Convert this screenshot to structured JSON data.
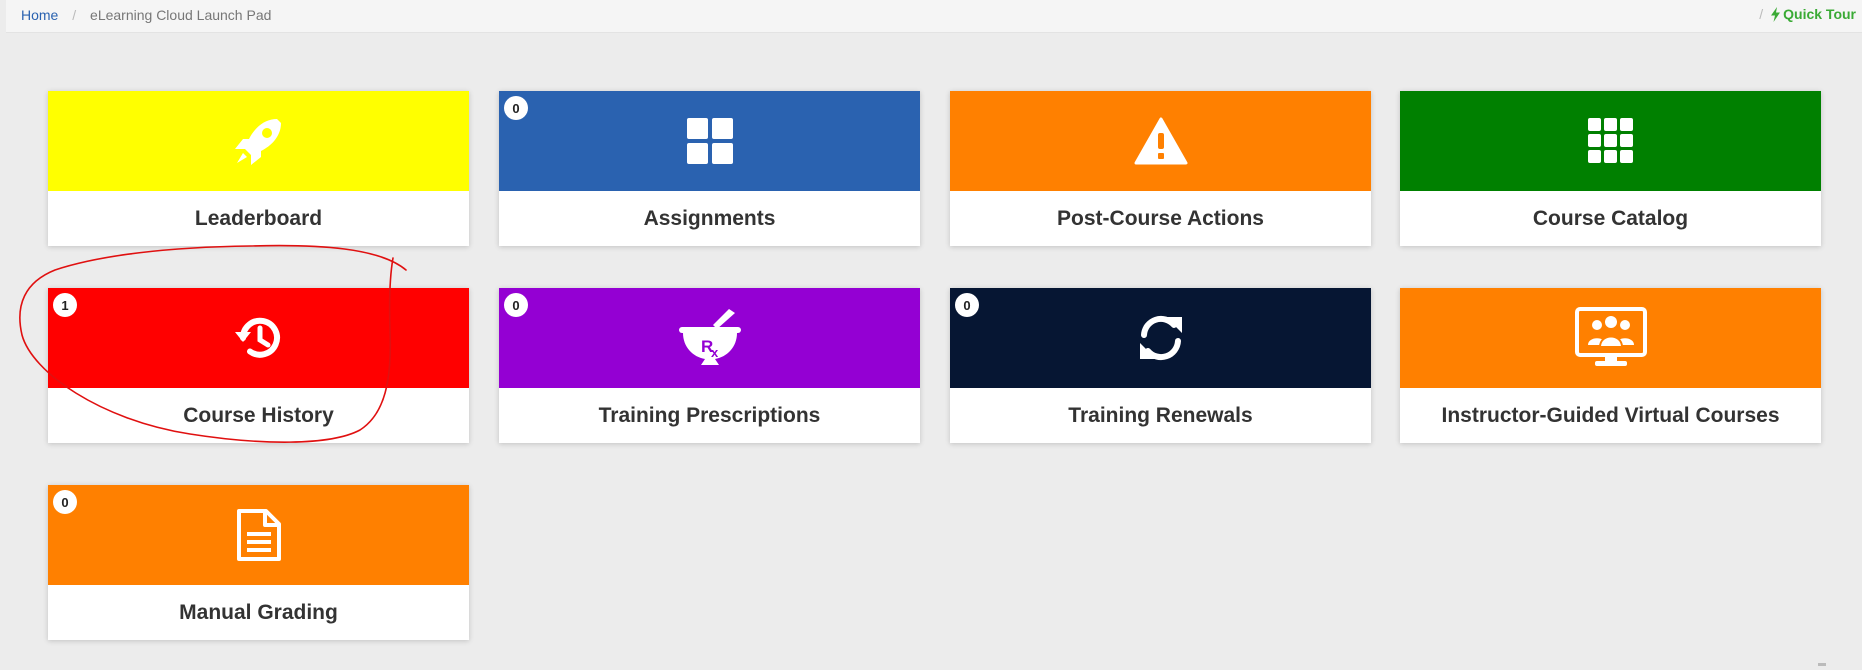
{
  "breadcrumb": {
    "home": "Home",
    "separator": "/",
    "current": "eLearning Cloud Launch Pad"
  },
  "quick_tour": {
    "separator": "/",
    "label": "Quick Tour",
    "color": "#3aaa35",
    "icon": "bolt-icon"
  },
  "tiles": [
    {
      "label": "Leaderboard",
      "color": "#ffff00",
      "icon": "rocket-icon",
      "badge": null
    },
    {
      "label": "Assignments",
      "color": "#2a62b0",
      "icon": "grid-icon",
      "badge": "0"
    },
    {
      "label": "Post-Course Actions",
      "color": "#ff8000",
      "icon": "warning-icon",
      "badge": null
    },
    {
      "label": "Course Catalog",
      "color": "#008000",
      "icon": "apps-grid-icon",
      "badge": null
    },
    {
      "label": "Course History",
      "color": "#ff0000",
      "icon": "history-icon",
      "badge": "1"
    },
    {
      "label": "Training Prescriptions",
      "color": "#9400d3",
      "icon": "mortar-pestle-rx-icon",
      "badge": "0"
    },
    {
      "label": "Training Renewals",
      "color": "#061633",
      "icon": "refresh-icon",
      "badge": "0"
    },
    {
      "label": "Instructor-Guided Virtual Courses",
      "color": "#ff8000",
      "icon": "virtual-classroom-icon",
      "badge": null
    },
    {
      "label": "Manual Grading",
      "color": "#ff8000",
      "icon": "document-icon",
      "badge": "0"
    }
  ],
  "annotation": {
    "color": "#e01010",
    "shape": "hand-drawn circle around Course History"
  }
}
